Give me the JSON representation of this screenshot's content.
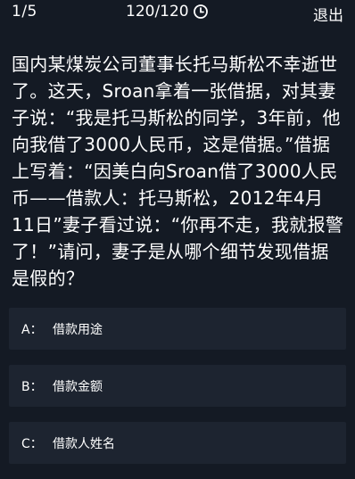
{
  "header": {
    "progress": "1/5",
    "timer": "120/120",
    "exit_label": "退出"
  },
  "question": {
    "text": "国内某煤炭公司董事长托马斯松不幸逝世了。这天，Sroan拿着一张借据，对其妻子说：“我是托马斯松的同学，3年前，他向我借了3000人民币，这是借据。”借据上写着：“因美白向Sroan借了3000人民币——借款人：托马斯松，2012年4月11日”妻子看过说：“你再不走，我就报警了！”请问，妻子是从哪个细节发现借据是假的？"
  },
  "options": [
    {
      "letter": "A：",
      "text": "借款用途"
    },
    {
      "letter": "B：",
      "text": "借款金额"
    },
    {
      "letter": "C：",
      "text": "借款人姓名"
    }
  ],
  "icons": {
    "clock": "clock-icon"
  }
}
